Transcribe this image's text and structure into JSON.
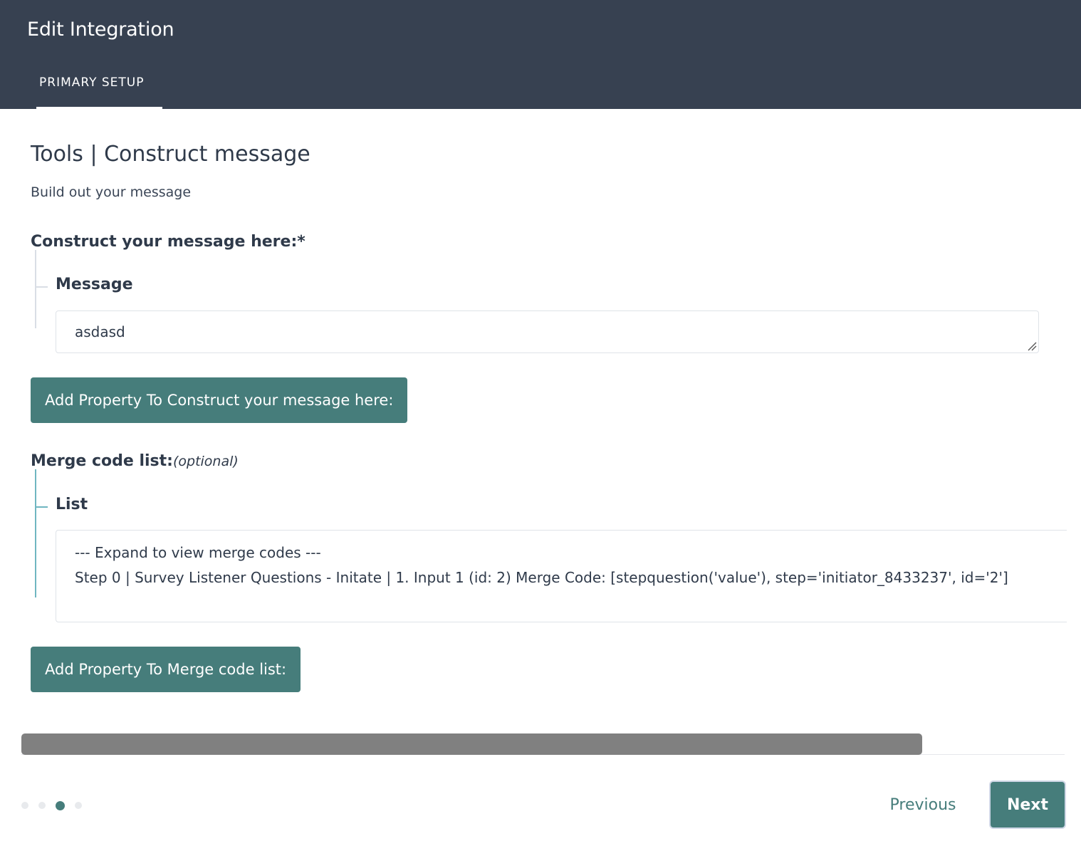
{
  "header": {
    "title": "Edit Integration",
    "tabs": [
      {
        "label": "PRIMARY SETUP"
      }
    ]
  },
  "page": {
    "title": "Tools | Construct message",
    "subtitle": "Build out your message"
  },
  "construct": {
    "label": "Construct your message here:*",
    "field_label": "Message",
    "value": "asdasd",
    "add_button": "Add Property To Construct your message here:"
  },
  "merge": {
    "label": "Merge code list:",
    "optional": "(optional)",
    "field_label": "List",
    "lines": [
      "--- Expand to view merge codes ---",
      "Step 0 | Survey Listener Questions - Initate | 1. Input 1 (id: 2) Merge Code: [stepquestion('value'), step='initiator_8433237', id='2']"
    ],
    "add_button": "Add Property To Merge code list:"
  },
  "footer": {
    "steps_total": 4,
    "steps_current": 3,
    "previous_label": "Previous",
    "next_label": "Next"
  },
  "colors": {
    "header_bg": "#374151",
    "accent": "#467d7b",
    "scroll_thumb": "#808080"
  }
}
